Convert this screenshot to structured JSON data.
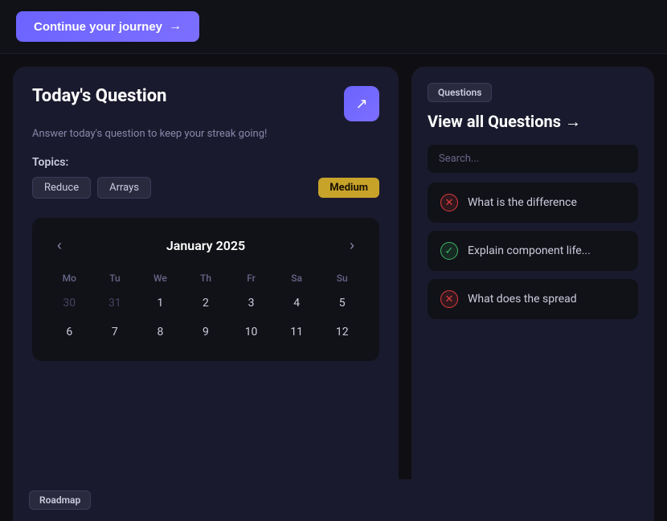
{
  "topBar": {
    "continueButton": {
      "label": "Continue your journey",
      "arrow": "→"
    }
  },
  "todayQuestion": {
    "title": "Today's Question",
    "subtitle": "Answer today's question to keep your streak going!",
    "topicsLabel": "Topics:",
    "tags": [
      "Reduce",
      "Arrays"
    ],
    "difficulty": "Medium",
    "externalLinkIcon": "↗"
  },
  "calendar": {
    "monthYear": "January 2025",
    "prevIcon": "‹",
    "nextIcon": "›",
    "dayHeaders": [
      "Mo",
      "Tu",
      "We",
      "Th",
      "Fr",
      "Sa",
      "Su"
    ],
    "weeks": [
      [
        {
          "label": "30",
          "inactive": true
        },
        {
          "label": "31",
          "inactive": true
        },
        {
          "label": "1"
        },
        {
          "label": "2"
        },
        {
          "label": "3"
        },
        {
          "label": "4"
        },
        {
          "label": "5"
        }
      ],
      [
        {
          "label": "6"
        },
        {
          "label": "7"
        },
        {
          "label": "8"
        },
        {
          "label": "9"
        },
        {
          "label": "10"
        },
        {
          "label": "11"
        },
        {
          "label": "12"
        }
      ]
    ]
  },
  "rightPanel": {
    "badgeLabel": "Questions",
    "viewAllLabel": "View all Questions →",
    "searchPlaceholder": "Search...",
    "questions": [
      {
        "text": "What is the difference",
        "status": "wrong",
        "statusSymbol": "✕"
      },
      {
        "text": "Explain component life...",
        "status": "correct",
        "statusSymbol": "✓"
      },
      {
        "text": "What does the spread",
        "status": "wrong",
        "statusSymbol": "✕"
      }
    ]
  },
  "bottomSection": {
    "roadmapLabel": "Roadmap"
  }
}
